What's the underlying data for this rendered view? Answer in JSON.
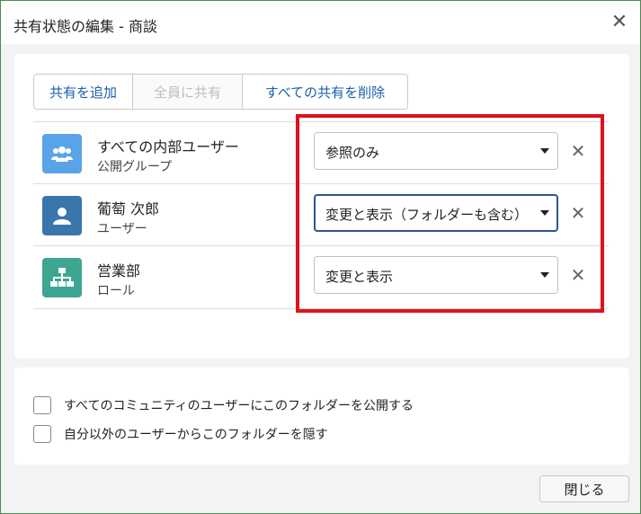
{
  "dialog": {
    "title": "共有状態の編集 - 商談",
    "close_icon": "close-icon"
  },
  "toolbar": {
    "add_share": "共有を追加",
    "share_all": "全員に共有",
    "remove_all": "すべての共有を削除"
  },
  "shares": [
    {
      "name": "すべての内部ユーザー",
      "type": "公開グループ",
      "access": "参照のみ",
      "icon": "group-icon",
      "color": "#5ba3e8"
    },
    {
      "name": "葡萄 次郎",
      "type": "ユーザー",
      "access": "変更と表示（フォルダーも含む）",
      "icon": "user-icon",
      "color": "#3a76ad"
    },
    {
      "name": "営業部",
      "type": "ロール",
      "access": "変更と表示",
      "icon": "role-hierarchy-icon",
      "color": "#3ea592"
    }
  ],
  "options": {
    "publish_to_community": "すべてのコミュニティのユーザーにこのフォルダーを公開する",
    "hide_from_others": "自分以外のユーザーからこのフォルダーを隠す"
  },
  "footer": {
    "close_label": "閉じる"
  },
  "colors": {
    "highlight": "#e0111c",
    "link_blue": "#1b5faa",
    "focus_border": "#2b5494"
  }
}
